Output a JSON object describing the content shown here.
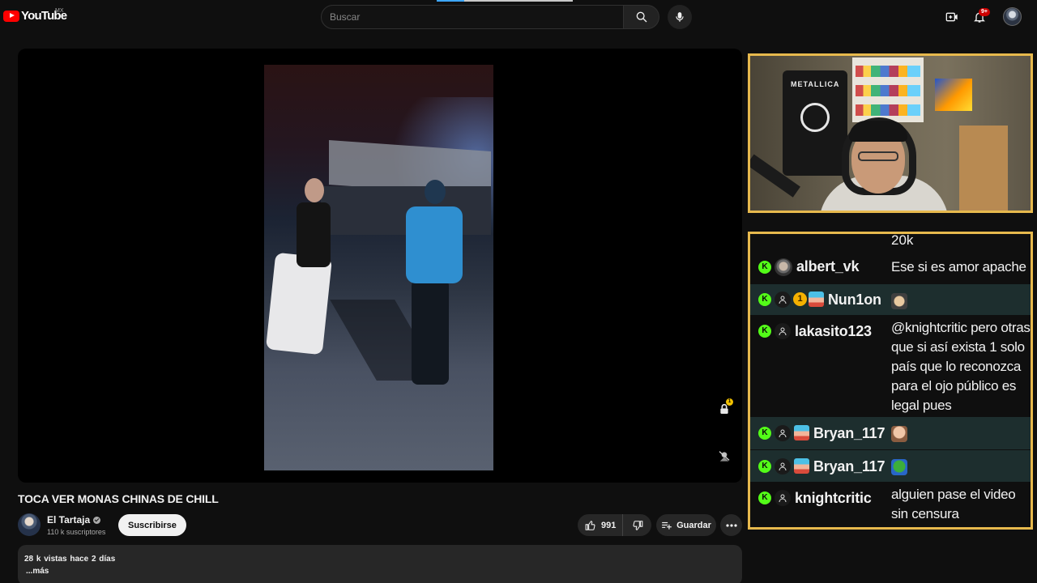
{
  "header": {
    "logo_text": "YouTube",
    "region": "MX",
    "search_placeholder": "Buscar",
    "notifications_badge": "9+"
  },
  "video": {
    "title": "TOCA VER MONAS CHINAS DE CHILL",
    "lock_badge": "1"
  },
  "channel": {
    "name": "El Tartaja",
    "subscribers": "110 k suscriptores",
    "subscribe_label": "Suscribirse"
  },
  "actions": {
    "like_count": "991",
    "save_label": "Guardar"
  },
  "description": {
    "meta": "28 k vistas  hace 2 días",
    "more": "...más"
  },
  "webcam": {
    "poster_text": "METALLICA"
  },
  "chat": {
    "top_fragment": "20k",
    "messages": [
      {
        "user": "albert_vk",
        "text": "Ese si es amor apache"
      },
      {
        "user": "Nun1on",
        "level": "1",
        "text": ""
      },
      {
        "user": "lakasito123",
        "text": "@knightcritic pero otras que si así exista 1 solo país que lo reconozca para el ojo público es legal pues"
      },
      {
        "user": "Bryan_117",
        "text": ""
      },
      {
        "user": "Bryan_117",
        "text": ""
      },
      {
        "user": "knightcritic",
        "text": "alguien pase el video sin censura"
      }
    ]
  },
  "colors": {
    "accent_red": "#ff0000",
    "overlay_border": "#e7b94d",
    "kick_green": "#53fc18",
    "chat_alt_row": "#1d2e2e"
  }
}
